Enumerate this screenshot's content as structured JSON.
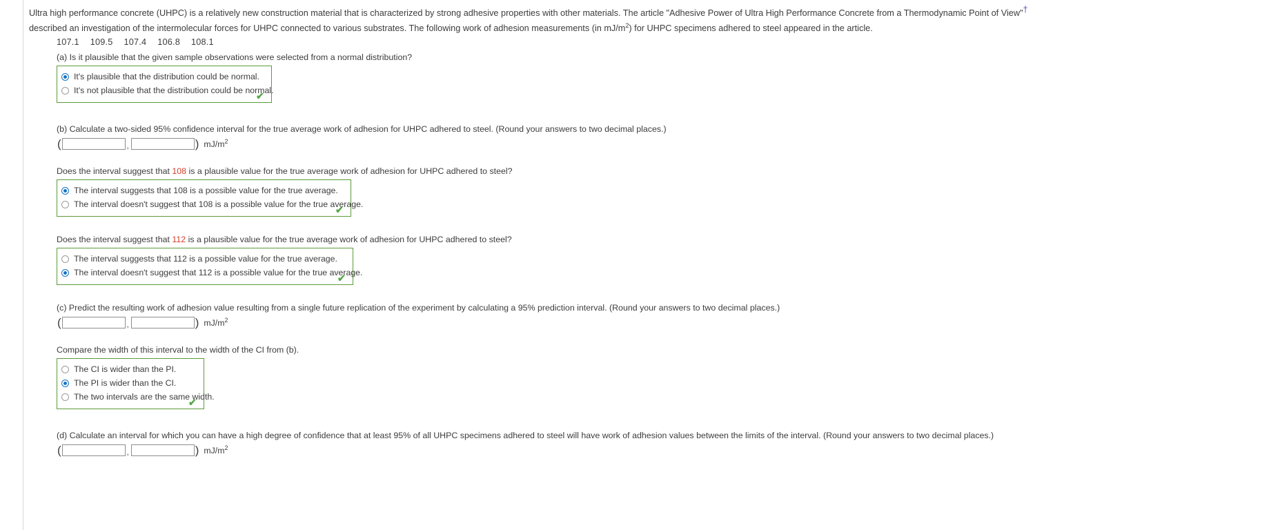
{
  "intro": {
    "part1": "Ultra high performance concrete (UHPC) is a relatively new construction material that is characterized by strong adhesive properties with other materials. The article \"Adhesive Power of Ultra High Performance Concrete from a Thermodynamic Point of View\"",
    "dagger": "†",
    "part2": " described an investigation of the intermolecular forces for UHPC connected to various substrates. The following work of adhesion measurements (in mJ/m",
    "exponent": "2",
    "part3": ") for UHPC specimens adhered to steel appeared in the article."
  },
  "data_values": [
    "107.1",
    "109.5",
    "107.4",
    "106.8",
    "108.1"
  ],
  "units": {
    "text": "mJ/m",
    "exponent": "2"
  },
  "parts": {
    "a": {
      "question": "(a) Is it plausible that the given sample observations were selected from a normal distribution?",
      "options": [
        {
          "label": "It's plausible that the distribution could be normal.",
          "selected": true
        },
        {
          "label": "It's not plausible that the distribution could be normal.",
          "selected": false
        }
      ],
      "check": "✔"
    },
    "b": {
      "question": "(b) Calculate a two-sided 95% confidence interval for the true average work of adhesion for UHPC adhered to steel. (Round your answers to two decimal places.)",
      "lower_value": "",
      "upper_value": "",
      "open_paren": "(",
      "comma": ",",
      "close_paren": ")"
    },
    "b108": {
      "question_pre": "Does the interval suggest that ",
      "highlight": "108",
      "question_post": " is a plausible value for the true average work of adhesion for UHPC adhered to steel?",
      "options": [
        {
          "label": "The interval suggests that 108 is a possible value for the true average.",
          "selected": true
        },
        {
          "label": "The interval doesn't suggest that 108 is a possible value for the true average.",
          "selected": false
        }
      ],
      "check": "✔"
    },
    "b112": {
      "question_pre": "Does the interval suggest that ",
      "highlight": "112",
      "question_post": " is a plausible value for the true average work of adhesion for UHPC adhered to steel?",
      "options": [
        {
          "label": "The interval suggests that 112 is a possible value for the true average.",
          "selected": false
        },
        {
          "label": "The interval doesn't suggest that 112 is a possible value for the true average.",
          "selected": true
        }
      ],
      "check": "✔"
    },
    "c": {
      "question": "(c) Predict the resulting work of adhesion value resulting from a single future replication of the experiment by calculating a 95% prediction interval. (Round your answers to two decimal places.)",
      "lower_value": "",
      "upper_value": ""
    },
    "compare": {
      "question": "Compare the width of this interval to the width of the CI from (b).",
      "options": [
        {
          "label": "The CI is wider than the PI.",
          "selected": false
        },
        {
          "label": "The PI is wider than the CI.",
          "selected": true
        },
        {
          "label": "The two intervals are the same width.",
          "selected": false
        }
      ],
      "check": "✔"
    },
    "d": {
      "question": "(d) Calculate an interval for which you can have a high degree of confidence that at least 95% of all UHPC specimens adhered to steel will have work of adhesion values between the limits of the interval. (Round your answers to two decimal places.)",
      "lower_value": "",
      "upper_value": ""
    }
  },
  "colors": {
    "box_border": "#5c9a37",
    "check": "#53a846",
    "highlight": "#d63b28",
    "radio_selected": "#1673c4",
    "link": "#4b52b6"
  }
}
